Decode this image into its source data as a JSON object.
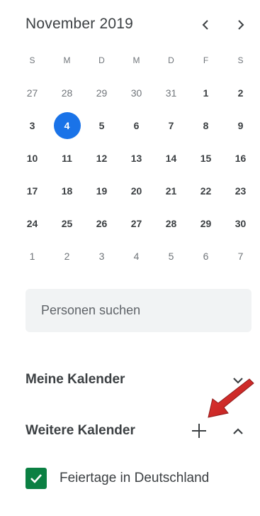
{
  "mini_calendar": {
    "month_label": "November 2019",
    "prev_icon": "chevron-left-icon",
    "next_icon": "chevron-right-icon",
    "weekdays": [
      "S",
      "M",
      "D",
      "M",
      "D",
      "F",
      "S"
    ],
    "weeks": [
      [
        "27",
        "28",
        "29",
        "30",
        "31",
        "1",
        "2"
      ],
      [
        "3",
        "4",
        "5",
        "6",
        "7",
        "8",
        "9"
      ],
      [
        "10",
        "11",
        "12",
        "13",
        "14",
        "15",
        "16"
      ],
      [
        "17",
        "18",
        "19",
        "20",
        "21",
        "22",
        "23"
      ],
      [
        "24",
        "25",
        "26",
        "27",
        "28",
        "29",
        "30"
      ],
      [
        "1",
        "2",
        "3",
        "4",
        "5",
        "6",
        "7"
      ]
    ],
    "selected_day": "4",
    "selected_color": "#1a73e8"
  },
  "people_search": {
    "placeholder": "Personen suchen"
  },
  "my_calendars": {
    "title": "Meine Kalender",
    "toggle_icon": "chevron-down-icon"
  },
  "other_calendars": {
    "title": "Weitere Kalender",
    "add_icon": "plus-icon",
    "toggle_icon": "chevron-up-icon",
    "items": [
      {
        "label": "Feiertage in Deutschland",
        "checked": true,
        "color": "#0b8043"
      }
    ]
  },
  "annotation": {
    "icon": "red-arrow-icon",
    "color": "#c62828"
  }
}
